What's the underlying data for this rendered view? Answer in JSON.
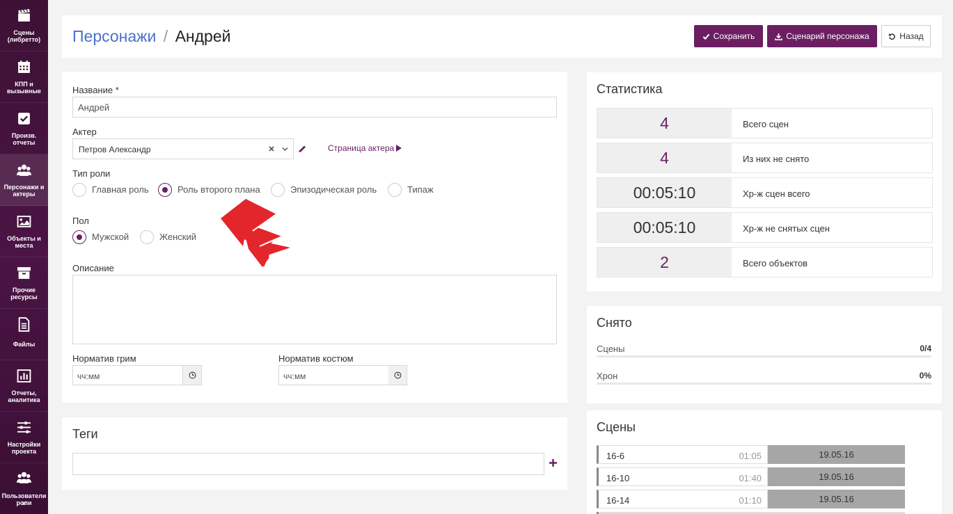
{
  "sidebar": {
    "items": [
      {
        "label_l1": "Сцены",
        "label_l2": "(либретто)",
        "icon": "clapperboard-icon"
      },
      {
        "label_l1": "КПП и",
        "label_l2": "вызывные",
        "icon": "calendar-icon"
      },
      {
        "label_l1": "Произв.",
        "label_l2": "отчеты",
        "icon": "checkbox-icon"
      },
      {
        "label_l1": "Персонажи и",
        "label_l2": "актеры",
        "icon": "users-icon"
      },
      {
        "label_l1": "Объекты и",
        "label_l2": "места",
        "icon": "image-icon"
      },
      {
        "label_l1": "Прочие",
        "label_l2": "ресурсы",
        "icon": "archive-icon"
      },
      {
        "label_l1": "Файлы",
        "label_l2": "",
        "icon": "file-icon"
      },
      {
        "label_l1": "Отчеты,",
        "label_l2": "аналитика",
        "icon": "bar-chart-icon"
      },
      {
        "label_l1": "Настройки",
        "label_l2": "проекта",
        "icon": "sliders-icon"
      },
      {
        "label_l1": "Пользователи и",
        "label_l2": "роли",
        "icon": "users-icon"
      }
    ]
  },
  "header": {
    "breadcrumb_link": "Персонажи",
    "separator": "/",
    "title": "Андрей",
    "save_label": "Сохранить",
    "script_label": "Сценарий персонажа",
    "back_label": "Назад"
  },
  "form": {
    "name_label": "Название",
    "required_mark": "*",
    "name_value": "Андрей",
    "actor_label": "Актер",
    "actor_value": "Петров Александр",
    "actor_page_link": "Страница актера",
    "role_type_label": "Тип роли",
    "role_options": [
      "Главная роль",
      "Роль второго плана",
      "Эпизодическая роль",
      "Типаж"
    ],
    "role_selected": "Роль второго плана",
    "gender_label": "Пол",
    "gender_options": [
      "Мужской",
      "Женский"
    ],
    "gender_selected": "Мужской",
    "description_label": "Описание",
    "description_value": "",
    "makeup_label": "Норматив грим",
    "makeup_placeholder": "чч:мм",
    "costume_label": "Норматив костюм",
    "costume_placeholder": "чч:мм"
  },
  "tags": {
    "title": "Теги",
    "input_value": "",
    "add_icon": "plus-icon"
  },
  "statistics": {
    "title": "Статистика",
    "rows": [
      {
        "value": "4",
        "label": "Всего сцен"
      },
      {
        "value": "4",
        "label": "Из них не снято"
      },
      {
        "value": "00:05:10",
        "label": "Хр-ж сцен всего"
      },
      {
        "value": "00:05:10",
        "label": "Хр-ж не снятых сцен"
      },
      {
        "value": "2",
        "label": "Всего объектов"
      }
    ]
  },
  "shot": {
    "title": "Снято",
    "scenes_label": "Сцены",
    "scenes_value": "0/4",
    "scenes_fraction": 0,
    "chron_label": "Хрон",
    "chron_value": "0%",
    "chron_fraction": 0
  },
  "scenes": {
    "title": "Сцены",
    "rows": [
      {
        "name": "16-6",
        "time": "01:05",
        "date": "19.05.16"
      },
      {
        "name": "16-10",
        "time": "01:40",
        "date": "19.05.16"
      },
      {
        "name": "16-14",
        "time": "01:10",
        "date": "19.05.16"
      }
    ]
  },
  "colors": {
    "accent": "#6b1f62",
    "sidebar_bg": "#3d1136",
    "arrow_red": "#e3262b",
    "scene_date_bg": "#a6a6a6"
  }
}
